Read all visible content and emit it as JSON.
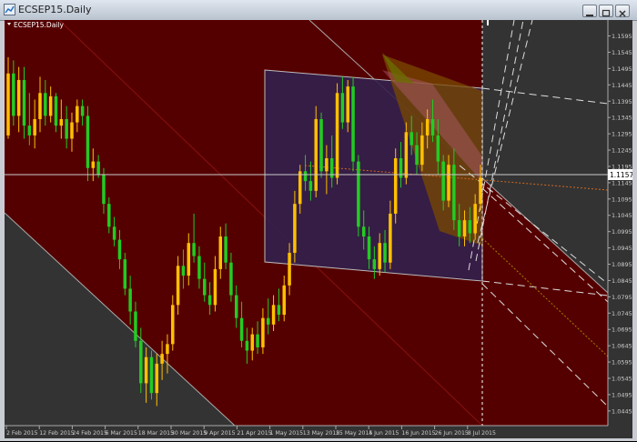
{
  "window": {
    "title": "ECSEP15.Daily"
  },
  "chart_data": {
    "type": "candlestick",
    "title": "ECSEP15.Daily",
    "ylim": [
      1.04,
      1.163
    ],
    "y_ticks": [
      "1.1595",
      "1.1545",
      "1.1495",
      "1.1445",
      "1.1395",
      "1.1345",
      "1.1295",
      "1.1245",
      "1.1195",
      "1.1145",
      "1.1095",
      "1.1045",
      "1.0995",
      "1.0945",
      "1.0895",
      "1.0845",
      "1.0795",
      "1.0745",
      "1.0695",
      "1.0645",
      "1.0595",
      "1.0545",
      "1.0495",
      "1.0445"
    ],
    "x_ticks": [
      "2 Feb 2015",
      "12 Feb 2015",
      "24 Feb 2015",
      "6 Mar 2015",
      "18 Mar 2015",
      "30 Mar 2015",
      "9 Apr 2015",
      "21 Apr 2015",
      "1 May 2015",
      "13 May 2015",
      "25 May 2015",
      "4 Jun 2015",
      "16 Jun 2015",
      "26 Jun 2015",
      "8 Jul 2015"
    ],
    "current_price": "1.1157",
    "colors": {
      "up": "#ffc000",
      "down": "#22cc22",
      "background": "#550000",
      "grid": "#ffffff"
    },
    "candles": [
      {
        "o": 1.129,
        "h": 1.153,
        "l": 1.128,
        "c": 1.148
      },
      {
        "o": 1.148,
        "h": 1.152,
        "l": 1.132,
        "c": 1.135
      },
      {
        "o": 1.135,
        "h": 1.15,
        "l": 1.13,
        "c": 1.146
      },
      {
        "o": 1.146,
        "h": 1.15,
        "l": 1.128,
        "c": 1.132
      },
      {
        "o": 1.132,
        "h": 1.142,
        "l": 1.126,
        "c": 1.129
      },
      {
        "o": 1.129,
        "h": 1.14,
        "l": 1.125,
        "c": 1.134
      },
      {
        "o": 1.134,
        "h": 1.147,
        "l": 1.13,
        "c": 1.142
      },
      {
        "o": 1.142,
        "h": 1.146,
        "l": 1.132,
        "c": 1.135
      },
      {
        "o": 1.135,
        "h": 1.144,
        "l": 1.133,
        "c": 1.141
      },
      {
        "o": 1.141,
        "h": 1.142,
        "l": 1.13,
        "c": 1.132
      },
      {
        "o": 1.132,
        "h": 1.14,
        "l": 1.128,
        "c": 1.134
      },
      {
        "o": 1.134,
        "h": 1.138,
        "l": 1.125,
        "c": 1.128
      },
      {
        "o": 1.128,
        "h": 1.136,
        "l": 1.124,
        "c": 1.133
      },
      {
        "o": 1.133,
        "h": 1.14,
        "l": 1.13,
        "c": 1.138
      },
      {
        "o": 1.138,
        "h": 1.14,
        "l": 1.132,
        "c": 1.135
      },
      {
        "o": 1.135,
        "h": 1.138,
        "l": 1.115,
        "c": 1.119
      },
      {
        "o": 1.119,
        "h": 1.125,
        "l": 1.115,
        "c": 1.121
      },
      {
        "o": 1.121,
        "h": 1.123,
        "l": 1.116,
        "c": 1.117
      },
      {
        "o": 1.117,
        "h": 1.119,
        "l": 1.105,
        "c": 1.108
      },
      {
        "o": 1.108,
        "h": 1.11,
        "l": 1.099,
        "c": 1.101
      },
      {
        "o": 1.101,
        "h": 1.104,
        "l": 1.095,
        "c": 1.097
      },
      {
        "o": 1.097,
        "h": 1.1,
        "l": 1.088,
        "c": 1.091
      },
      {
        "o": 1.091,
        "h": 1.093,
        "l": 1.08,
        "c": 1.082
      },
      {
        "o": 1.082,
        "h": 1.086,
        "l": 1.071,
        "c": 1.075
      },
      {
        "o": 1.075,
        "h": 1.078,
        "l": 1.064,
        "c": 1.066
      },
      {
        "o": 1.066,
        "h": 1.07,
        "l": 1.05,
        "c": 1.053
      },
      {
        "o": 1.053,
        "h": 1.064,
        "l": 1.047,
        "c": 1.061
      },
      {
        "o": 1.061,
        "h": 1.063,
        "l": 1.048,
        "c": 1.05
      },
      {
        "o": 1.05,
        "h": 1.062,
        "l": 1.046,
        "c": 1.059
      },
      {
        "o": 1.059,
        "h": 1.066,
        "l": 1.054,
        "c": 1.062
      },
      {
        "o": 1.062,
        "h": 1.068,
        "l": 1.056,
        "c": 1.065
      },
      {
        "o": 1.065,
        "h": 1.08,
        "l": 1.063,
        "c": 1.077
      },
      {
        "o": 1.077,
        "h": 1.092,
        "l": 1.074,
        "c": 1.089
      },
      {
        "o": 1.089,
        "h": 1.094,
        "l": 1.082,
        "c": 1.086
      },
      {
        "o": 1.086,
        "h": 1.099,
        "l": 1.083,
        "c": 1.096
      },
      {
        "o": 1.096,
        "h": 1.105,
        "l": 1.09,
        "c": 1.092
      },
      {
        "o": 1.092,
        "h": 1.095,
        "l": 1.082,
        "c": 1.085
      },
      {
        "o": 1.085,
        "h": 1.09,
        "l": 1.078,
        "c": 1.08
      },
      {
        "o": 1.08,
        "h": 1.084,
        "l": 1.074,
        "c": 1.077
      },
      {
        "o": 1.077,
        "h": 1.092,
        "l": 1.075,
        "c": 1.088
      },
      {
        "o": 1.088,
        "h": 1.101,
        "l": 1.085,
        "c": 1.098
      },
      {
        "o": 1.098,
        "h": 1.102,
        "l": 1.088,
        "c": 1.09
      },
      {
        "o": 1.09,
        "h": 1.093,
        "l": 1.078,
        "c": 1.08
      },
      {
        "o": 1.08,
        "h": 1.083,
        "l": 1.07,
        "c": 1.073
      },
      {
        "o": 1.073,
        "h": 1.078,
        "l": 1.064,
        "c": 1.066
      },
      {
        "o": 1.066,
        "h": 1.07,
        "l": 1.059,
        "c": 1.063
      },
      {
        "o": 1.063,
        "h": 1.07,
        "l": 1.06,
        "c": 1.068
      },
      {
        "o": 1.068,
        "h": 1.072,
        "l": 1.062,
        "c": 1.064
      },
      {
        "o": 1.064,
        "h": 1.076,
        "l": 1.062,
        "c": 1.073
      },
      {
        "o": 1.073,
        "h": 1.079,
        "l": 1.068,
        "c": 1.071
      },
      {
        "o": 1.071,
        "h": 1.08,
        "l": 1.069,
        "c": 1.077
      },
      {
        "o": 1.077,
        "h": 1.082,
        "l": 1.072,
        "c": 1.074
      },
      {
        "o": 1.074,
        "h": 1.086,
        "l": 1.072,
        "c": 1.083
      },
      {
        "o": 1.083,
        "h": 1.096,
        "l": 1.08,
        "c": 1.093
      },
      {
        "o": 1.093,
        "h": 1.112,
        "l": 1.09,
        "c": 1.108
      },
      {
        "o": 1.108,
        "h": 1.12,
        "l": 1.105,
        "c": 1.118
      },
      {
        "o": 1.118,
        "h": 1.123,
        "l": 1.112,
        "c": 1.115
      },
      {
        "o": 1.115,
        "h": 1.121,
        "l": 1.109,
        "c": 1.112
      },
      {
        "o": 1.112,
        "h": 1.138,
        "l": 1.11,
        "c": 1.134
      },
      {
        "o": 1.134,
        "h": 1.136,
        "l": 1.116,
        "c": 1.118
      },
      {
        "o": 1.118,
        "h": 1.126,
        "l": 1.111,
        "c": 1.122
      },
      {
        "o": 1.122,
        "h": 1.129,
        "l": 1.113,
        "c": 1.116
      },
      {
        "o": 1.116,
        "h": 1.145,
        "l": 1.114,
        "c": 1.142
      },
      {
        "o": 1.142,
        "h": 1.147,
        "l": 1.131,
        "c": 1.133
      },
      {
        "o": 1.133,
        "h": 1.146,
        "l": 1.13,
        "c": 1.144
      },
      {
        "o": 1.144,
        "h": 1.147,
        "l": 1.118,
        "c": 1.121
      },
      {
        "o": 1.121,
        "h": 1.123,
        "l": 1.098,
        "c": 1.101
      },
      {
        "o": 1.101,
        "h": 1.106,
        "l": 1.094,
        "c": 1.098
      },
      {
        "o": 1.098,
        "h": 1.101,
        "l": 1.088,
        "c": 1.091
      },
      {
        "o": 1.091,
        "h": 1.095,
        "l": 1.085,
        "c": 1.088
      },
      {
        "o": 1.088,
        "h": 1.099,
        "l": 1.086,
        "c": 1.096
      },
      {
        "o": 1.096,
        "h": 1.1,
        "l": 1.087,
        "c": 1.09
      },
      {
        "o": 1.09,
        "h": 1.109,
        "l": 1.088,
        "c": 1.105
      },
      {
        "o": 1.105,
        "h": 1.125,
        "l": 1.102,
        "c": 1.122
      },
      {
        "o": 1.122,
        "h": 1.127,
        "l": 1.113,
        "c": 1.116
      },
      {
        "o": 1.116,
        "h": 1.133,
        "l": 1.114,
        "c": 1.13
      },
      {
        "o": 1.13,
        "h": 1.135,
        "l": 1.123,
        "c": 1.126
      },
      {
        "o": 1.126,
        "h": 1.13,
        "l": 1.117,
        "c": 1.12
      },
      {
        "o": 1.12,
        "h": 1.133,
        "l": 1.118,
        "c": 1.129
      },
      {
        "o": 1.129,
        "h": 1.137,
        "l": 1.125,
        "c": 1.134
      },
      {
        "o": 1.134,
        "h": 1.14,
        "l": 1.127,
        "c": 1.129
      },
      {
        "o": 1.129,
        "h": 1.134,
        "l": 1.117,
        "c": 1.121
      },
      {
        "o": 1.121,
        "h": 1.123,
        "l": 1.106,
        "c": 1.109
      },
      {
        "o": 1.109,
        "h": 1.123,
        "l": 1.107,
        "c": 1.12
      },
      {
        "o": 1.12,
        "h": 1.125,
        "l": 1.1,
        "c": 1.103
      },
      {
        "o": 1.103,
        "h": 1.108,
        "l": 1.095,
        "c": 1.098
      },
      {
        "o": 1.098,
        "h": 1.106,
        "l": 1.095,
        "c": 1.103
      },
      {
        "o": 1.103,
        "h": 1.107,
        "l": 1.096,
        "c": 1.099
      },
      {
        "o": 1.099,
        "h": 1.111,
        "l": 1.097,
        "c": 1.108
      },
      {
        "o": 1.108,
        "h": 1.12,
        "l": 1.106,
        "c": 1.116
      }
    ]
  }
}
